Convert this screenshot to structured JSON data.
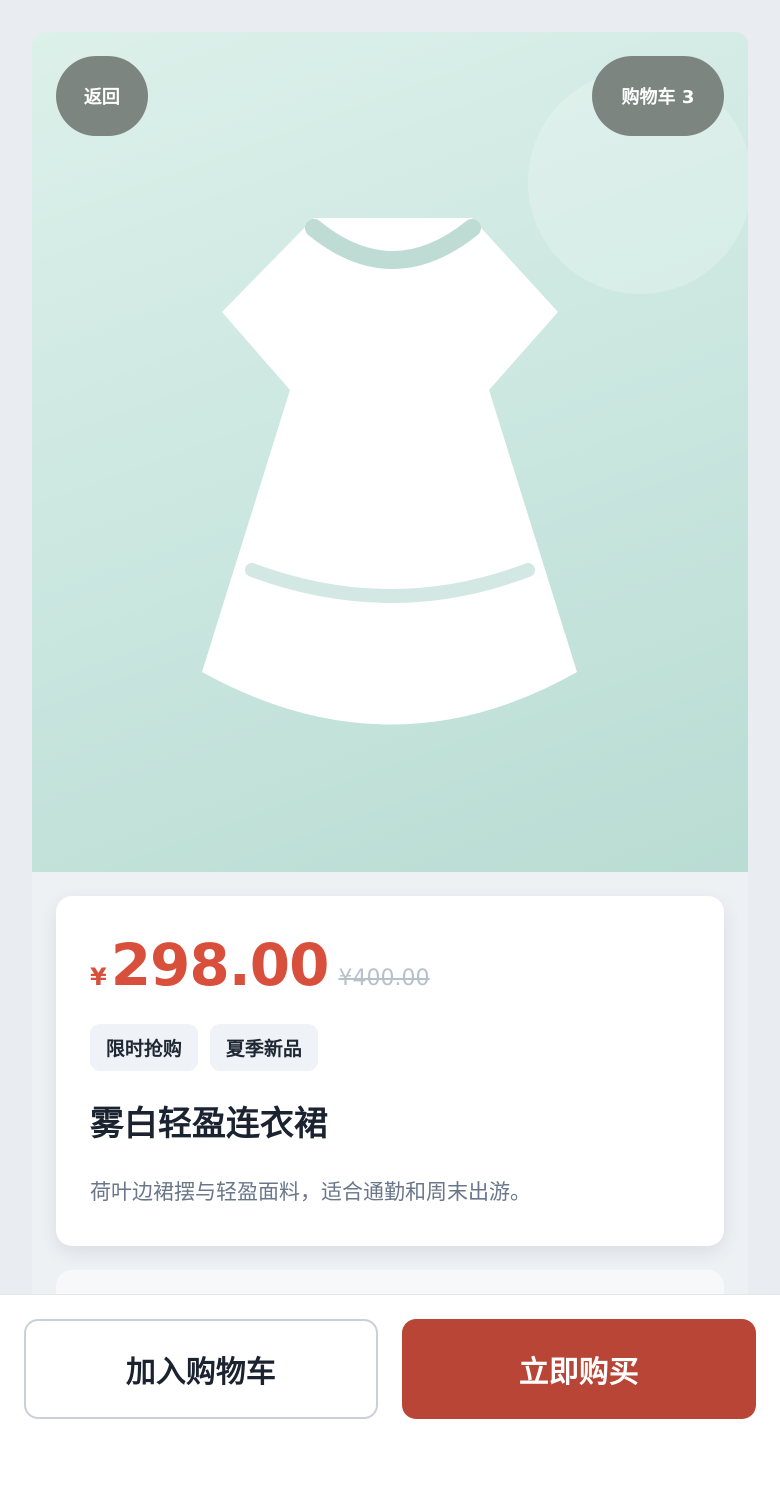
{
  "header": {
    "back_label": "返回",
    "cart_label": "购物车 3"
  },
  "product": {
    "currency_symbol": "¥",
    "price": "298.00",
    "original_price": "¥400.00",
    "tags": [
      "限时抢购",
      "夏季新品"
    ],
    "title": "雾白轻盈连衣裙",
    "description": "荷叶边裙摆与轻盈面料，适合通勤和周末出游。"
  },
  "actions": {
    "add_to_cart_label": "加入购物车",
    "buy_now_label": "立即购买"
  },
  "colors": {
    "accent_price": "#d84f3b",
    "buy_button": "#b84535",
    "hero_bg": "#c9e6df"
  },
  "icons": {
    "product_image": "dress-icon"
  }
}
